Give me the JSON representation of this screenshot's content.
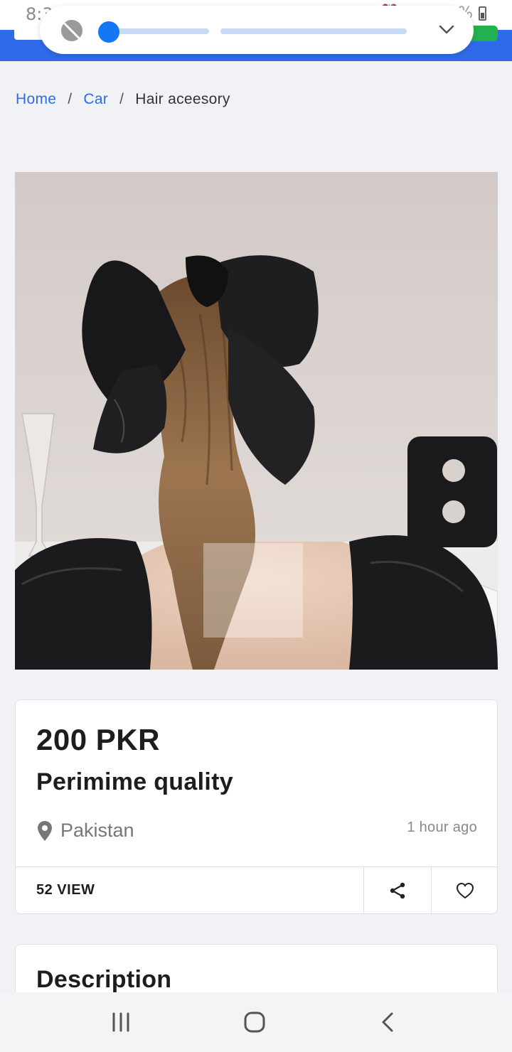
{
  "status_bar": {
    "time": "8:32",
    "battery": "51%"
  },
  "breadcrumb": {
    "items": [
      "Home",
      "Car",
      "Hair aceesory"
    ],
    "separator": "/"
  },
  "listing": {
    "price": "200 PKR",
    "title": "Perimime quality",
    "location": "Pakistan",
    "posted": "1 hour ago",
    "views": "52 VIEW"
  },
  "description": {
    "heading": "Description"
  },
  "colors": {
    "accent": "#2f6be8",
    "background": "#f1f2f5",
    "card": "#ffffff"
  },
  "icons": {
    "location": "map-pin-icon",
    "share": "share-icon",
    "favorite": "heart-icon"
  }
}
